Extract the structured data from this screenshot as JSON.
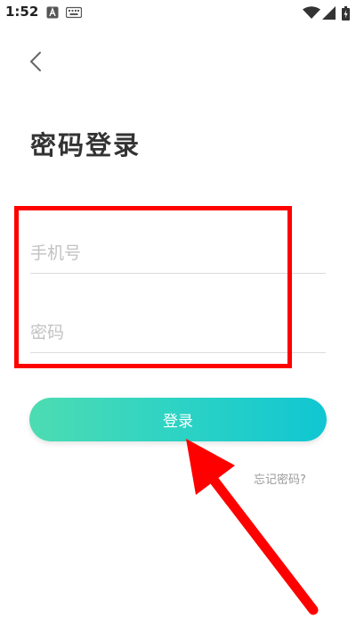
{
  "status_bar": {
    "time": "1:52",
    "icons": [
      "alert-a-icon",
      "keyboard-icon",
      "wifi-icon",
      "signal-icon",
      "battery-icon"
    ]
  },
  "nav": {
    "back_icon": "chevron-left-icon"
  },
  "page": {
    "title": "密码登录"
  },
  "form": {
    "phone": {
      "value": "",
      "placeholder": "手机号"
    },
    "password": {
      "value": "",
      "placeholder": "密码"
    },
    "login_label": "登录",
    "forgot_label": "忘记密码?"
  },
  "colors": {
    "accent_start": "#4ddcb2",
    "accent_end": "#10c6d2",
    "annotation": "#ff0000"
  }
}
